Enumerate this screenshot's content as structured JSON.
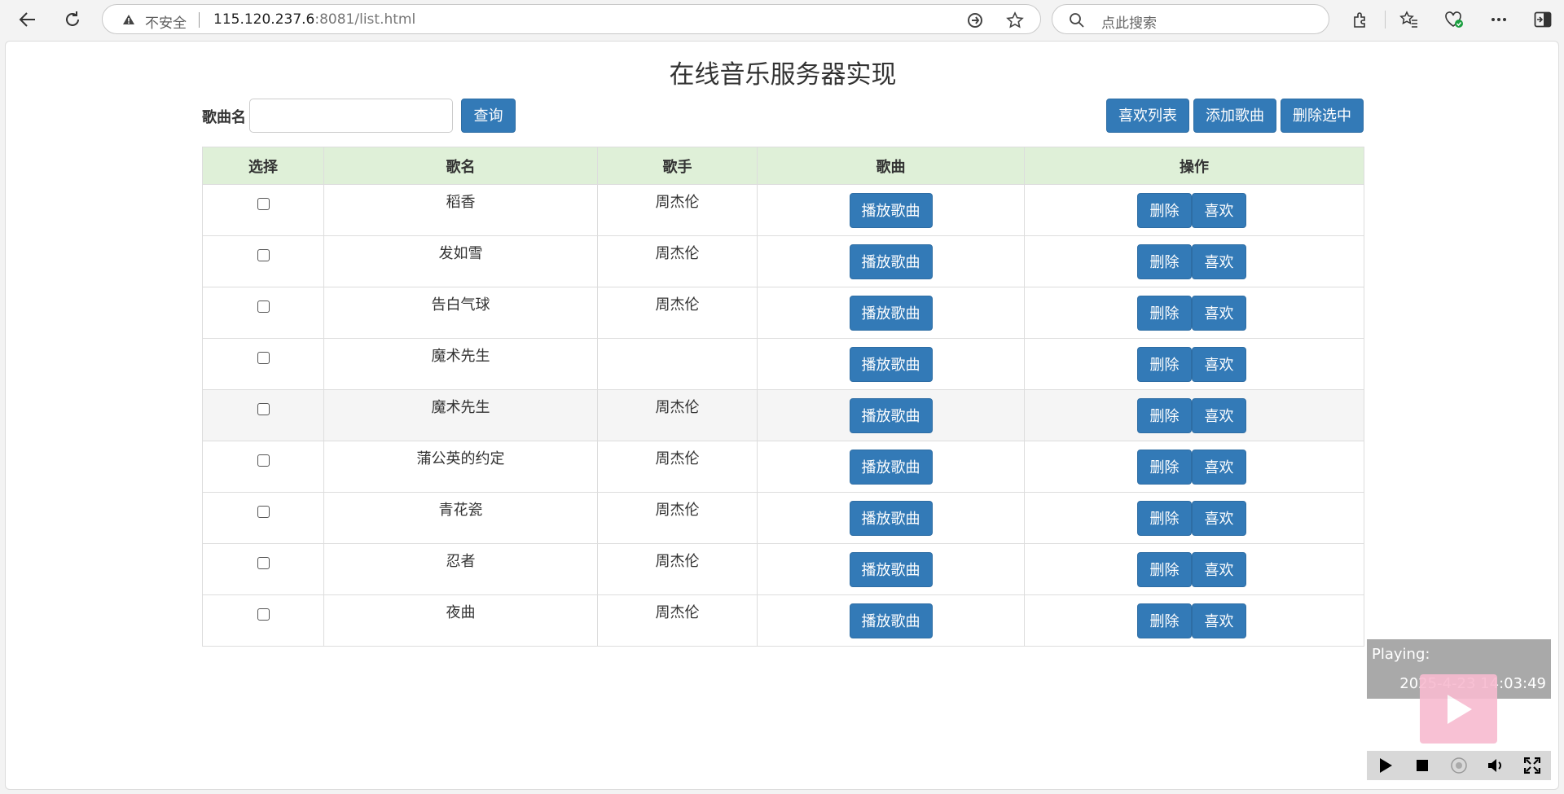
{
  "browser": {
    "security_label": "不安全",
    "url_host": "115.120.237.6",
    "url_rest": ":8081/list.html",
    "search_placeholder": "点此搜索"
  },
  "page": {
    "title": "在线音乐服务器实现",
    "search_label": "歌曲名",
    "search_value": "",
    "query_button": "查询",
    "buttons": {
      "favorites": "喜欢列表",
      "add": "添加歌曲",
      "delete_selected": "删除选中"
    }
  },
  "table": {
    "headers": [
      "选择",
      "歌名",
      "歌手",
      "歌曲",
      "操作"
    ],
    "rows": [
      {
        "title": "稻香",
        "artist": "周杰伦"
      },
      {
        "title": "发如雪",
        "artist": "周杰伦"
      },
      {
        "title": "告白气球",
        "artist": "周杰伦"
      },
      {
        "title": "魔术先生",
        "artist": ""
      },
      {
        "title": "魔术先生",
        "artist": "周杰伦"
      },
      {
        "title": "蒲公英的约定",
        "artist": "周杰伦"
      },
      {
        "title": "青花瓷",
        "artist": "周杰伦"
      },
      {
        "title": "忍者",
        "artist": "周杰伦"
      },
      {
        "title": "夜曲",
        "artist": "周杰伦"
      }
    ],
    "play_label": "播放歌曲",
    "delete_label": "删除",
    "like_label": "喜欢"
  },
  "player": {
    "status": "Playing:",
    "timestamp": "2025-4-23 14:03:49",
    "controls": [
      "play-icon",
      "stop-icon",
      "record-icon",
      "volume-icon",
      "fullscreen-icon"
    ]
  },
  "colors": {
    "primary": "#337ab7",
    "header_bg": "#dff0d8",
    "player_bg": "#a9a9a9",
    "overlay": "#f8bbd0"
  }
}
